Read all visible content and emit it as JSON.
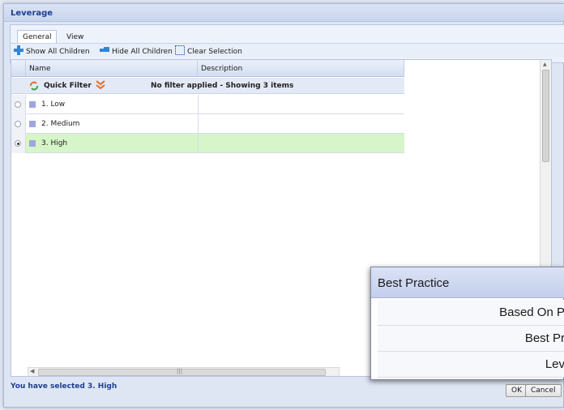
{
  "dialog": {
    "title": "Leverage"
  },
  "tabs": [
    {
      "label": "General",
      "active": true
    },
    {
      "label": "View",
      "active": false
    }
  ],
  "toolbar": {
    "show_all": "Show All Children",
    "hide_all": "Hide All Children",
    "clear_selection": "Clear Selection"
  },
  "grid": {
    "columns": [
      "Name",
      "Description"
    ],
    "filter_label": "Quick Filter",
    "filter_status": "No filter applied - Showing 3 items",
    "rows": [
      {
        "name": "1. Low",
        "description": "",
        "selected": false
      },
      {
        "name": "2. Medium",
        "description": "",
        "selected": false
      },
      {
        "name": "3. High",
        "description": "",
        "selected": true
      }
    ]
  },
  "status": {
    "text": "You have selected 3. High"
  },
  "buttons": {
    "ok": "OK",
    "cancel": "Cancel"
  },
  "popup": {
    "header": "Best Practice",
    "rows": [
      "Based On P",
      "Best Pr",
      "Lev"
    ]
  },
  "colors": {
    "accent": "#1c3f94",
    "selected_row": "#d6f5c8",
    "header_bg": "#c9d5ee"
  }
}
